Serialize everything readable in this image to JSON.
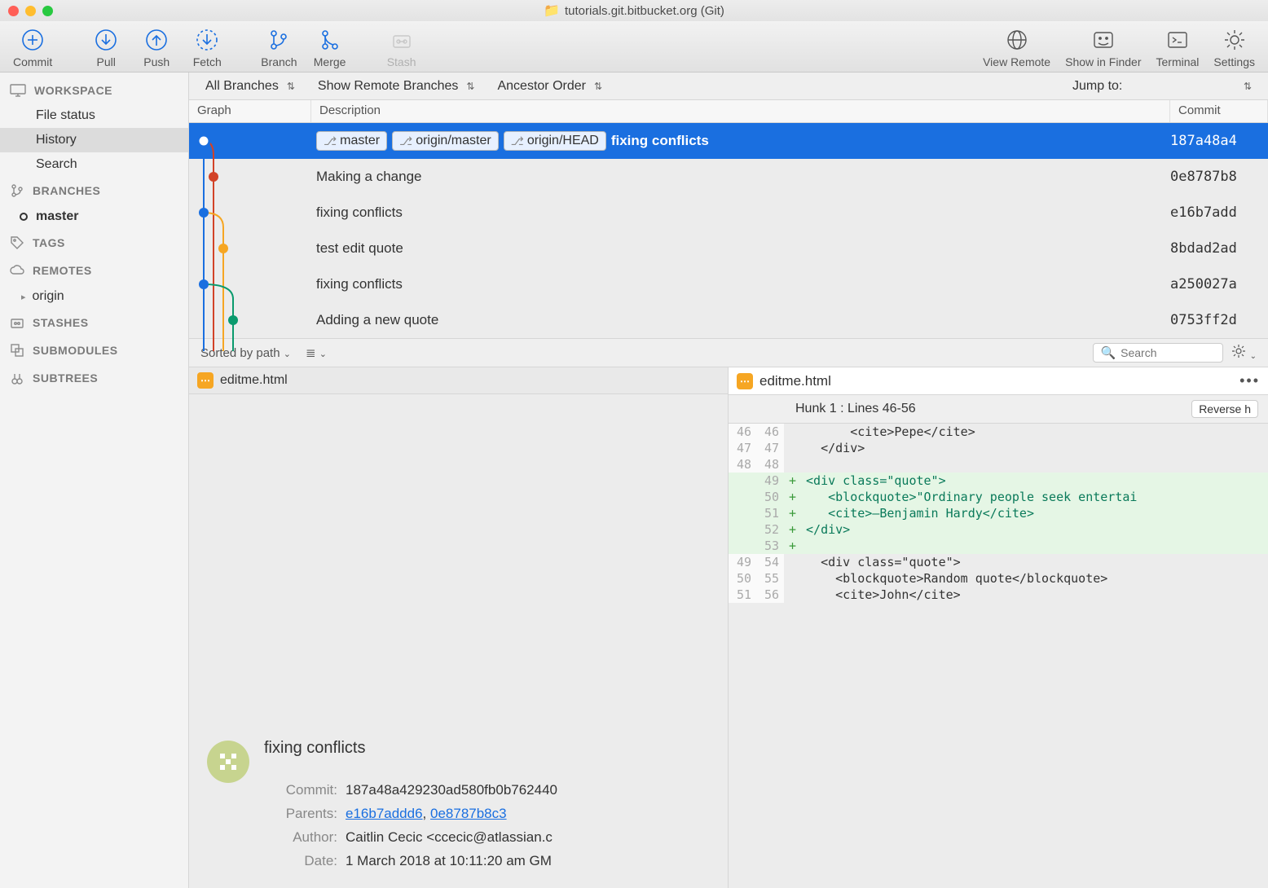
{
  "window": {
    "title": "tutorials.git.bitbucket.org (Git)"
  },
  "toolbar": {
    "commit": "Commit",
    "pull": "Pull",
    "push": "Push",
    "fetch": "Fetch",
    "branch": "Branch",
    "merge": "Merge",
    "stash": "Stash",
    "view_remote": "View Remote",
    "show_in_finder": "Show in Finder",
    "terminal": "Terminal",
    "settings": "Settings"
  },
  "sidebar": {
    "workspace": "WORKSPACE",
    "file_status": "File status",
    "history": "History",
    "search": "Search",
    "branches": "BRANCHES",
    "master": "master",
    "tags": "TAGS",
    "remotes": "REMOTES",
    "origin": "origin",
    "stashes": "STASHES",
    "submodules": "SUBMODULES",
    "subtrees": "SUBTREES"
  },
  "filters": {
    "all_branches": "All Branches",
    "show_remote": "Show Remote Branches",
    "order": "Ancestor Order",
    "jump": "Jump to:"
  },
  "columns": {
    "graph": "Graph",
    "description": "Description",
    "commit": "Commit"
  },
  "commits": [
    {
      "tags": [
        "master",
        "origin/master",
        "origin/HEAD"
      ],
      "msg": "fixing conflicts",
      "hash": "187a48a4"
    },
    {
      "tags": [],
      "msg": "Making a change",
      "hash": "0e8787b8"
    },
    {
      "tags": [],
      "msg": "fixing conflicts",
      "hash": "e16b7add"
    },
    {
      "tags": [],
      "msg": "test edit quote",
      "hash": "8bdad2ad"
    },
    {
      "tags": [],
      "msg": "fixing conflicts",
      "hash": "a250027a"
    },
    {
      "tags": [],
      "msg": "Adding a new quote",
      "hash": "0753ff2d"
    }
  ],
  "midbar": {
    "sorted": "Sorted by path",
    "search_ph": "Search"
  },
  "left": {
    "file": "editme.html",
    "commit_msg": "fixing conflicts",
    "labels": {
      "commit": "Commit:",
      "parents": "Parents:",
      "author": "Author:",
      "date": "Date:"
    },
    "commit_hash": "187a48a429230ad580fb0b762440",
    "parent1": "e16b7addd6",
    "parent2": "0e8787b8c3",
    "author": "Caitlin Cecic <ccecic@atlassian.c",
    "date": "1 March 2018 at 10:11:20 am GM"
  },
  "right": {
    "file": "editme.html",
    "hunk": "Hunk 1 : Lines 46-56",
    "reverse": "Reverse h",
    "lines": [
      {
        "o": "46",
        "n": "46",
        "m": " ",
        "t": "      <cite>Pepe</cite>"
      },
      {
        "o": "47",
        "n": "47",
        "m": " ",
        "t": "  </div>"
      },
      {
        "o": "48",
        "n": "48",
        "m": " ",
        "t": ""
      },
      {
        "o": "",
        "n": "49",
        "m": "+",
        "t": "<div class=\"quote\">"
      },
      {
        "o": "",
        "n": "50",
        "m": "+",
        "t": "   <blockquote>\"Ordinary people seek entertai"
      },
      {
        "o": "",
        "n": "51",
        "m": "+",
        "t": "   <cite>—Benjamin Hardy</cite>"
      },
      {
        "o": "",
        "n": "52",
        "m": "+",
        "t": "</div>"
      },
      {
        "o": "",
        "n": "53",
        "m": "+",
        "t": ""
      },
      {
        "o": "49",
        "n": "54",
        "m": " ",
        "t": "  <div class=\"quote\">"
      },
      {
        "o": "50",
        "n": "55",
        "m": " ",
        "t": "    <blockquote>Random quote</blockquote>"
      },
      {
        "o": "51",
        "n": "56",
        "m": " ",
        "t": "    <cite>John</cite>"
      }
    ]
  }
}
